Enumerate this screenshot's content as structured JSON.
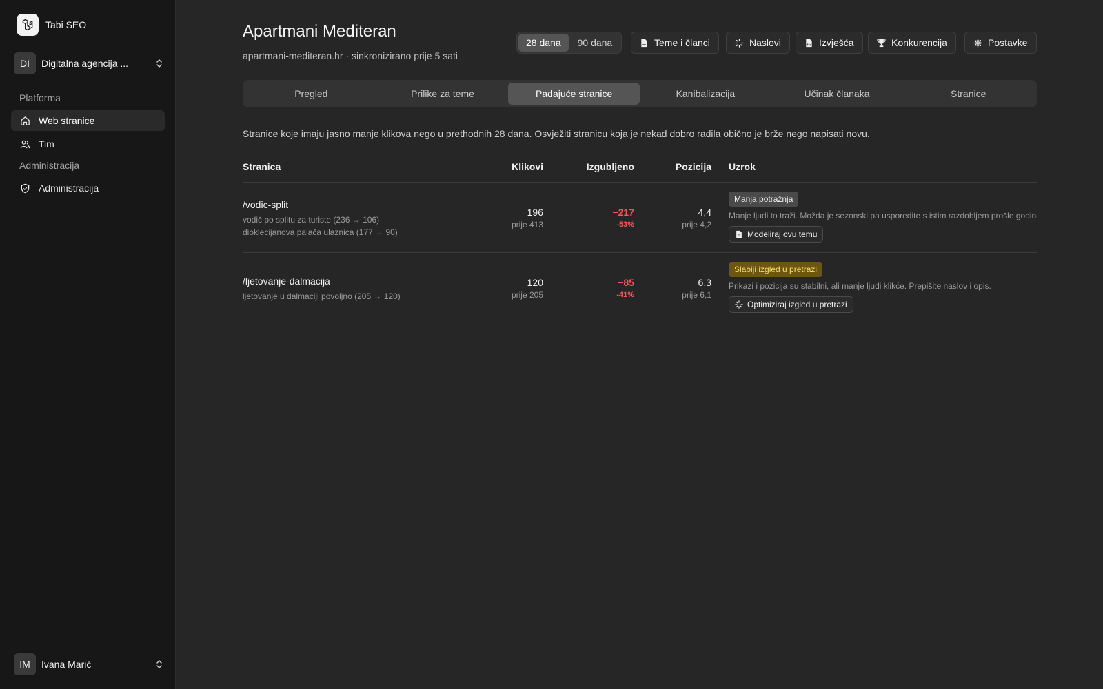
{
  "app": {
    "name": "Tabi SEO"
  },
  "org": {
    "initials": "DI",
    "name": "Digitalna agencija ..."
  },
  "sidebar": {
    "sections": [
      {
        "label": "Platforma",
        "items": [
          {
            "label": "Web stranice",
            "icon": "home-icon",
            "active": true
          },
          {
            "label": "Tim",
            "icon": "users-icon"
          }
        ]
      },
      {
        "label": "Administracija",
        "items": [
          {
            "label": "Administracija",
            "icon": "shield-icon"
          }
        ]
      }
    ]
  },
  "user": {
    "initials": "IM",
    "name": "Ivana Marić"
  },
  "header": {
    "title": "Apartmani Mediteran",
    "subtitle": "apartmani-mediteran.hr · sinkronizirano prije 5 sati",
    "range": [
      {
        "label": "28 dana",
        "selected": true
      },
      {
        "label": "90 dana",
        "selected": false
      }
    ],
    "buttons": [
      {
        "label": "Teme i članci",
        "icon": "document-icon"
      },
      {
        "label": "Naslovi",
        "icon": "sparkle-icon"
      },
      {
        "label": "Izvješća",
        "icon": "report-icon"
      },
      {
        "label": "Konkurencija",
        "icon": "trophy-icon"
      },
      {
        "label": "Postavke",
        "icon": "gear-icon"
      }
    ]
  },
  "tabs": [
    {
      "label": "Pregled"
    },
    {
      "label": "Prilike za teme"
    },
    {
      "label": "Padajuće stranice",
      "selected": true
    },
    {
      "label": "Kanibalizacija"
    },
    {
      "label": "Učinak članaka"
    },
    {
      "label": "Stranice"
    }
  ],
  "description": "Stranice koje imaju jasno manje klikova nego u prethodnih 28 dana. Osvježiti stranicu koja je nekad dobro radila obično je brže nego napisati novu.",
  "table": {
    "columns": {
      "page": "Stranica",
      "clicks": "Klikovi",
      "lost": "Izgubljeno",
      "position": "Pozicija",
      "cause": "Uzrok"
    },
    "rows": [
      {
        "path": "/vodic-split",
        "queries": [
          "vodič po splitu za turiste (236 → 106)",
          "dioklecijanova palača ulaznica (177 → 90)"
        ],
        "clicks": "196",
        "clicks_prev": "prije 413",
        "lost": "−217",
        "lost_pct": "-53%",
        "position": "4,4",
        "position_prev": "prije 4,2",
        "cause_badge": "Manja potražnja",
        "cause_color": "#4a4a4a",
        "cause_text": "Manje ljudi to traži. Možda je sezonski pa usporedite s istim razdobljem prošle godine.",
        "action": {
          "label": "Modeliraj ovu temu",
          "icon": "document-icon"
        }
      },
      {
        "path": "/ljetovanje-dalmacija",
        "queries": [
          "ljetovanje u dalmaciji povoljno (205 → 120)"
        ],
        "clicks": "120",
        "clicks_prev": "prije 205",
        "lost": "−85",
        "lost_pct": "-41%",
        "position": "6,3",
        "position_prev": "prije 6,1",
        "cause_badge": "Slabiji izgled u pretrazi",
        "cause_color": "#6d5512",
        "cause_text": "Prikazi i pozicija su stabilni, ali manje ljudi klikće. Prepišite naslov i opis.",
        "action": {
          "label": "Optimiziraj izgled u pretrazi",
          "icon": "sparkle-icon"
        }
      }
    ]
  }
}
